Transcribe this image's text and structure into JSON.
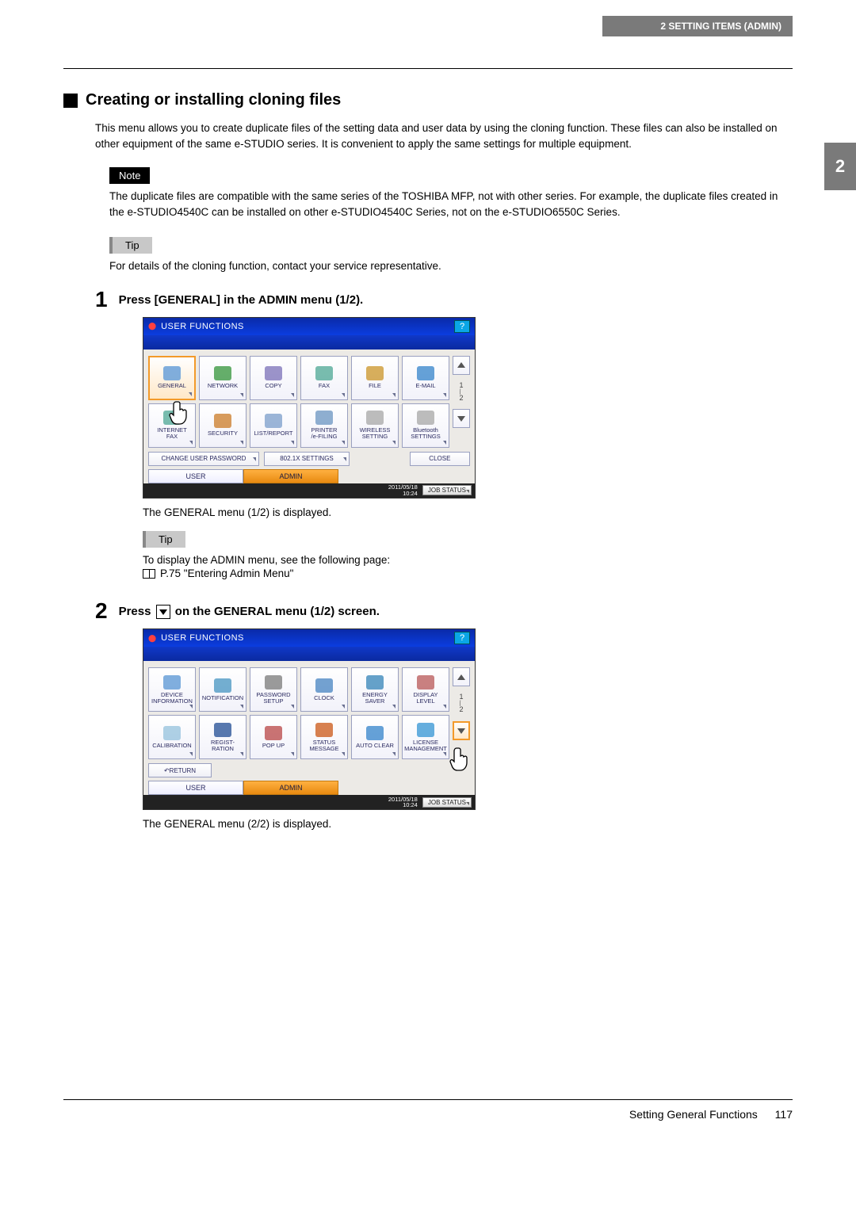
{
  "header": {
    "breadcrumb": "2 SETTING ITEMS (ADMIN)"
  },
  "chapter_tab": "2",
  "section": {
    "title": "Creating or installing cloning files",
    "intro": "This menu allows you to create duplicate files of the setting data and user data by using the cloning function. These files can also be installed on other equipment of the same e-STUDIO series. It is convenient to apply the same settings for multiple equipment."
  },
  "note": {
    "label": "Note",
    "body": "The duplicate files are compatible with the same series of the TOSHIBA MFP, not with other series. For example, the duplicate files created in the e-STUDIO4540C can be installed on other e-STUDIO4540C Series, not on the e-STUDIO6550C Series."
  },
  "tip1": {
    "label": "Tip",
    "body": "For details of the cloning function, contact your service representative."
  },
  "step1": {
    "num": "1",
    "title": "Press [GENERAL] in the ADMIN menu (1/2).",
    "result": "The GENERAL menu (1/2) is displayed."
  },
  "tip2": {
    "label": "Tip",
    "line1": "To display the ADMIN menu, see the following page:",
    "ref": "P.75 \"Entering Admin Menu\""
  },
  "step2": {
    "num": "2",
    "title_a": "Press ",
    "title_b": " on the GENERAL menu (1/2) screen.",
    "result": "The GENERAL menu (2/2) is displayed."
  },
  "screen_common": {
    "title": "USER FUNCTIONS",
    "help": "?",
    "page_current": "1",
    "page_total": "2",
    "tab_user": "USER",
    "tab_admin": "ADMIN",
    "datetime_l1": "2011/05/18",
    "datetime_l2": "10:24",
    "job_status": "JOB STATUS"
  },
  "screen1": {
    "icons_row1": [
      "GENERAL",
      "NETWORK",
      "COPY",
      "FAX",
      "FILE",
      "E-MAIL"
    ],
    "icons_row2": [
      "INTERNET\nFAX",
      "SECURITY",
      "LIST/REPORT",
      "PRINTER\n/e-FILING",
      "WIRELESS\nSETTING",
      "Bluetooth\nSETTINGS"
    ],
    "bottom_buttons": [
      "CHANGE USER PASSWORD",
      "802.1X SETTINGS",
      "CLOSE"
    ]
  },
  "screen2": {
    "icons_row1": [
      "DEVICE\nINFORMATION",
      "NOTIFICATION",
      "PASSWORD\nSETUP",
      "CLOCK",
      "ENERGY\nSAVER",
      "DISPLAY\nLEVEL"
    ],
    "icons_row2": [
      "CALIBRATION",
      "REGIST-\nRATION",
      "POP UP",
      "STATUS\nMESSAGE",
      "AUTO CLEAR",
      "LICENSE\nMANAGEMENT"
    ],
    "return": "RETURN"
  },
  "footer": {
    "chapter": "Setting General Functions",
    "page": "117"
  }
}
